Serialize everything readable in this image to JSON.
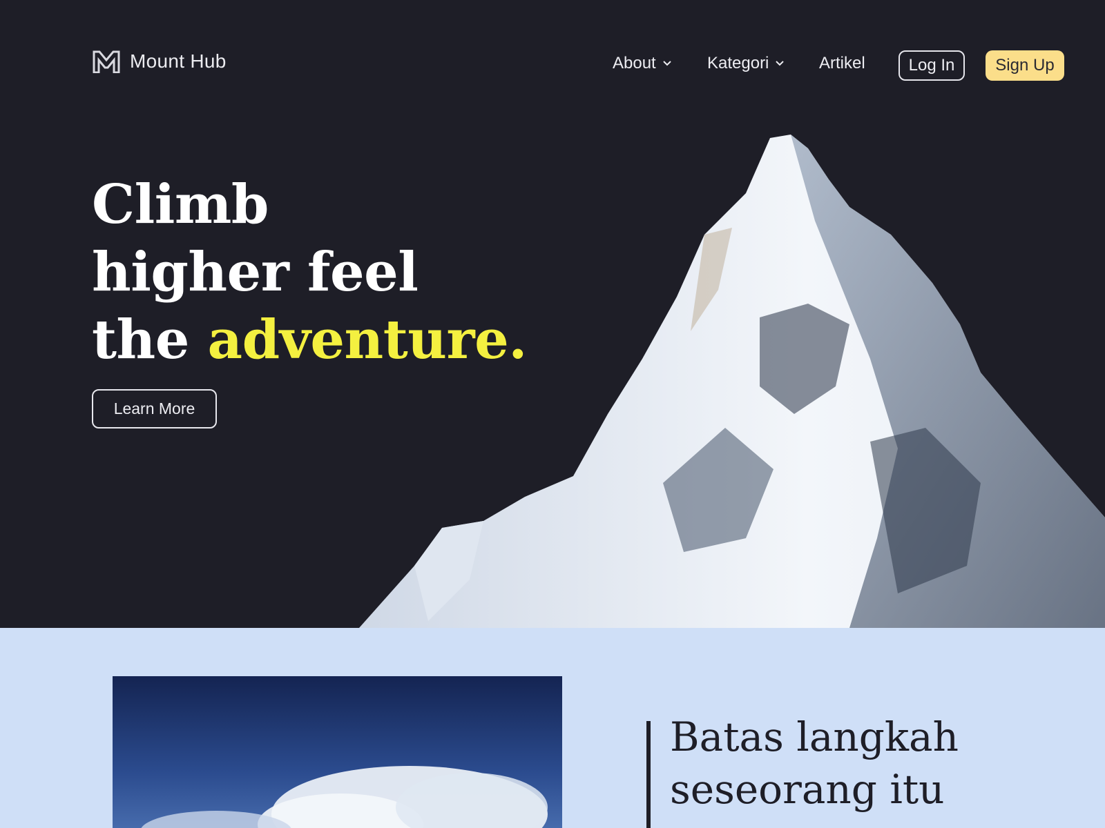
{
  "brand": {
    "name": "Mount Hub",
    "logo_icon": "mountain-logo-icon"
  },
  "nav": {
    "about": "About",
    "kategori": "Kategori",
    "artikel": "Artikel",
    "login": "Log In",
    "signup": "Sign Up"
  },
  "hero": {
    "line1": "Climb",
    "line2": "higher feel",
    "line3_prefix": "the ",
    "line3_accent": "adventure.",
    "cta": "Learn More"
  },
  "section2": {
    "quote_line1": "Batas langkah",
    "quote_line2": "seseorang itu"
  },
  "colors": {
    "background": "#1e1e27",
    "accent_yellow": "#f4f040",
    "signup_bg": "#fbde8a",
    "section2_bg": "#cfdff7"
  }
}
